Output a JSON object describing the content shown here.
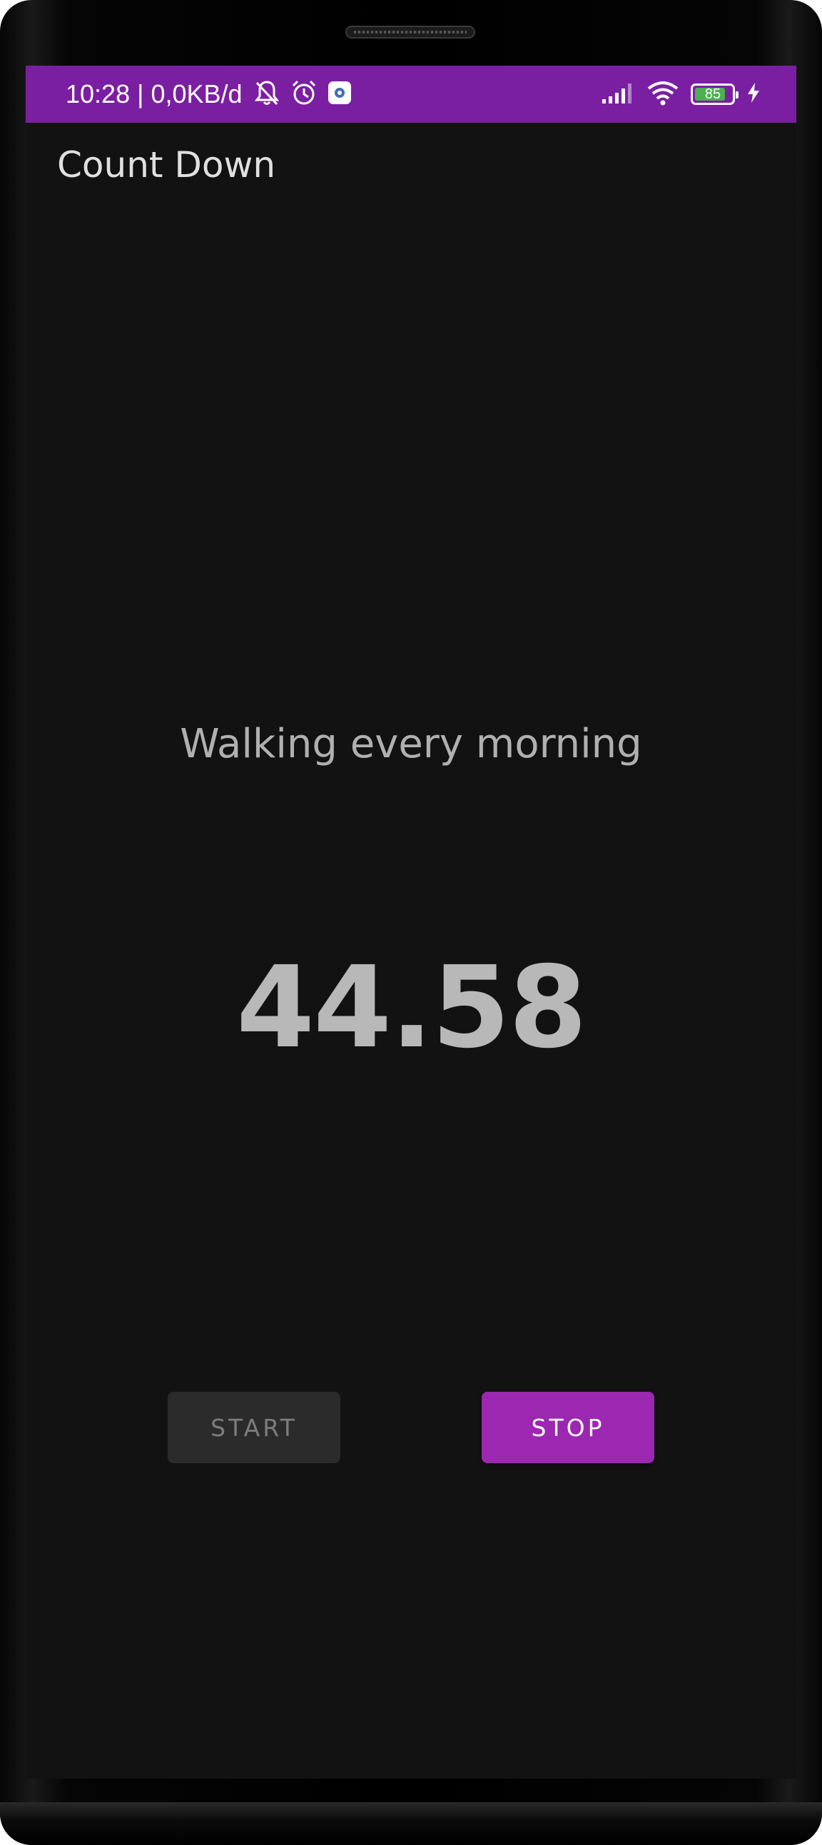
{
  "status_bar": {
    "text": "10:28 | 0,0KB/d",
    "battery_level": "85",
    "color": "#7b1fa2"
  },
  "app_bar": {
    "title": "Count Down"
  },
  "main": {
    "task_name": "Walking every morning",
    "timer_value": "44.58"
  },
  "buttons": {
    "start_label": "START",
    "stop_label": "STOP"
  },
  "colors": {
    "background": "#121212",
    "accent": "#9c27b0",
    "disabled_button": "#2b2b2b"
  }
}
